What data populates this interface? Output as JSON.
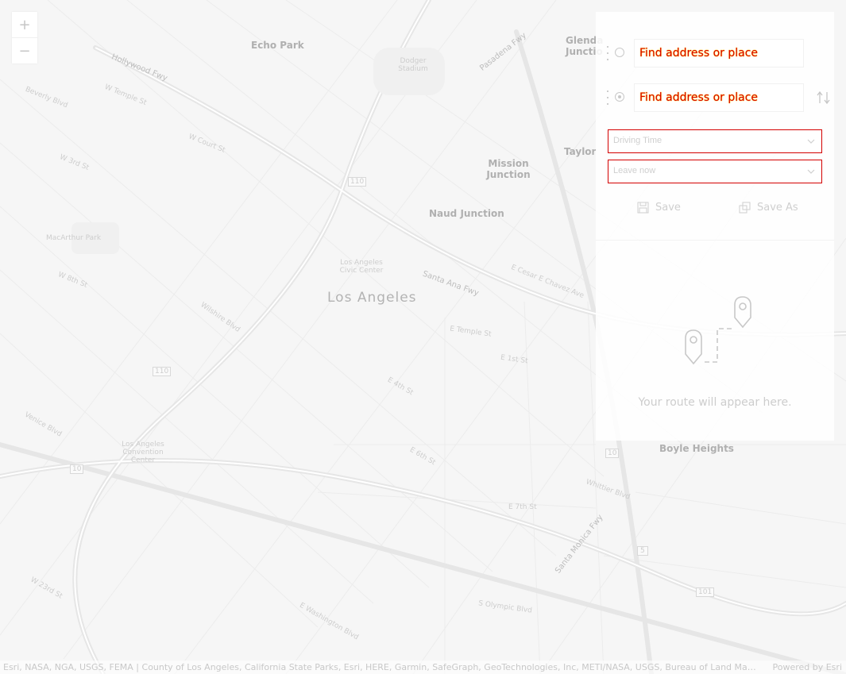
{
  "zoom": {
    "in_label": "+",
    "out_label": "−"
  },
  "map_labels": {
    "echo_park": "Echo Park",
    "dodger_stadium": "Dodger Stadium",
    "glendale_junction": "Glenda Junctio",
    "taylor": "Taylor",
    "mission_junction": "Mission Junction",
    "naud_junction": "Naud Junction",
    "los_angeles": "Los Angeles",
    "la_civic_center": "Los Angeles Civic Center",
    "macarthur_park": "MacArthur Park",
    "boyle_heights": "Boyle Heights",
    "convention_center": "Los Angeles Convention Center",
    "hollywood_fwy": "Hollywood Fwy",
    "pasadena_fwy": "Pasadena Fwy",
    "santa_ana_fwy": "Santa Ana Fwy",
    "santa_monica_fwy": "Santa Monica Fwy",
    "w_temple_st": "W Temple St",
    "beverly_blvd": "Beverly Blvd",
    "w_3rd_st": "W 3rd St",
    "w_court_st": "W Court St",
    "w_8th_st": "W 8th St",
    "wilshire_blvd": "Wilshire Blvd",
    "e_temple_st": "E Temple St",
    "e_1st_st": "E 1st St",
    "e_6th_st": "E 6th St",
    "e_7th_st": "E 7th St",
    "e_washington_blvd": "E Washington Blvd",
    "whittier_blvd": "Whittier Blvd",
    "e_cesar_chavez_ave": "E Cesar E Chavez Ave",
    "venice_blvd": "Venice Blvd",
    "w_23rd_st": "W 23rd St",
    "s_olympic_blvd": "S Olympic Blvd",
    "e_4th_st": "E 4th St",
    "shield_110": "110",
    "shield_10": "10",
    "shield_5": "5",
    "shield_101": "101"
  },
  "directions": {
    "origin": {
      "placeholder": "Find address or place"
    },
    "destination": {
      "placeholder": "Find address or place"
    },
    "travel_mode": "Driving Time",
    "departure": "Leave now",
    "save_label": "Save",
    "save_as_label": "Save As",
    "empty_message": "Your route will appear here."
  },
  "attribution": {
    "text": "Esri, NASA, NGA, USGS, FEMA | County of Los Angeles, California State Parks, Esri, HERE, Garmin, SafeGraph, GeoTechnologies, Inc, METI/NASA, USGS, Bureau of Land Mana...",
    "powered_by": "Powered by Esri"
  }
}
